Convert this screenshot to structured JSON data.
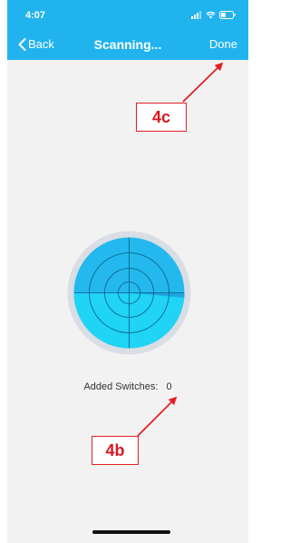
{
  "status_bar": {
    "time": "4:07",
    "icons": [
      "signal-icon",
      "wifi-icon",
      "battery-icon"
    ]
  },
  "nav": {
    "back_label": "Back",
    "title": "Scanning...",
    "done_label": "Done"
  },
  "scan": {
    "added_switches_label": "Added Switches:",
    "added_switches_count": "0"
  },
  "annotations": {
    "top_callout": "4c",
    "bottom_callout": "4b"
  },
  "colors": {
    "header_blue": "#21b3ee",
    "radar_blue": "#23b8ee",
    "callout_red": "#e31e24"
  }
}
